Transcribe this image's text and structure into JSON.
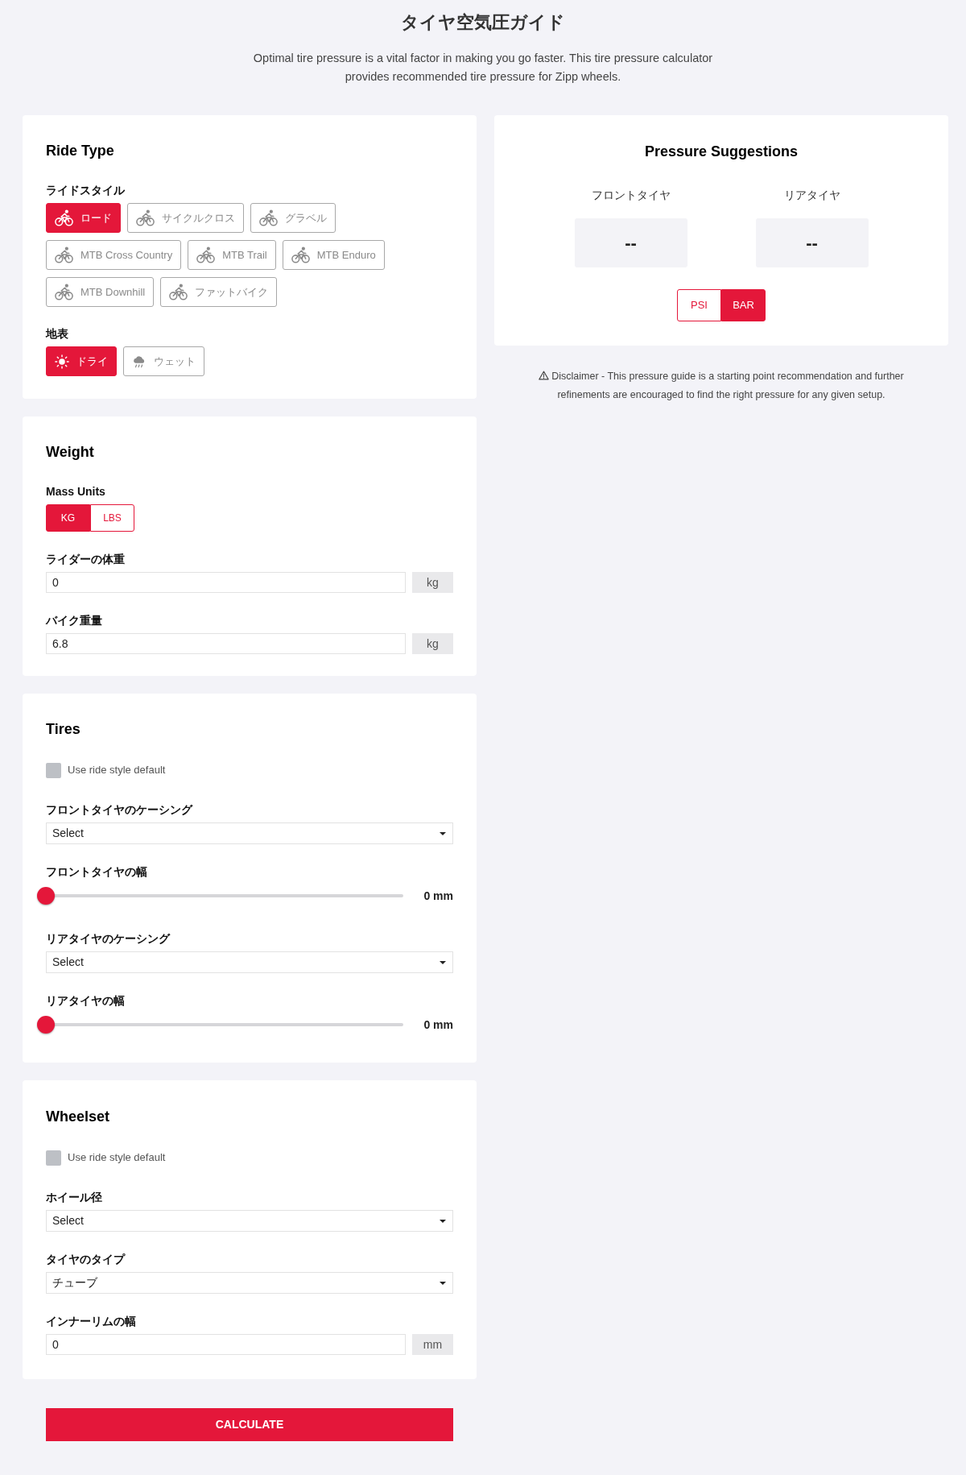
{
  "header": {
    "title": "タイヤ空気圧ガイド",
    "subtitle": "Optimal tire pressure is a vital factor in making you go faster. This tire pressure calculator provides recommended tire pressure for Zipp wheels."
  },
  "ride_type": {
    "title": "Ride Type",
    "ride_style": {
      "label": "ライドスタイル",
      "options": [
        {
          "label": "ロード",
          "selected": true
        },
        {
          "label": "サイクルクロス",
          "selected": false
        },
        {
          "label": "グラベル",
          "selected": false
        },
        {
          "label": "MTB Cross Country",
          "selected": false
        },
        {
          "label": "MTB Trail",
          "selected": false
        },
        {
          "label": "MTB Enduro",
          "selected": false
        },
        {
          "label": "MTB Downhill",
          "selected": false
        },
        {
          "label": "ファットバイク",
          "selected": false
        }
      ]
    },
    "surface": {
      "label": "地表",
      "options": [
        {
          "label": "ドライ",
          "kind": "sun",
          "selected": true
        },
        {
          "label": "ウェット",
          "kind": "rain",
          "selected": false
        }
      ]
    }
  },
  "weight": {
    "title": "Weight",
    "mass_units": {
      "label": "Mass Units",
      "options": [
        {
          "label": "KG",
          "selected": true
        },
        {
          "label": "LBS",
          "selected": false
        }
      ]
    },
    "fields": [
      {
        "label": "ライダーの体重",
        "value": "0",
        "unit": "kg"
      },
      {
        "label": "バイク重量",
        "value": "6.8",
        "unit": "kg"
      }
    ]
  },
  "tires": {
    "title": "Tires",
    "default_checkbox": {
      "label": "Use ride style default",
      "checked": false
    },
    "controls": [
      {
        "kind": "select",
        "label": "フロントタイヤのケーシング",
        "value": "Select"
      },
      {
        "kind": "slider",
        "label": "フロントタイヤの幅",
        "level": 0,
        "reading": "0 mm"
      },
      {
        "kind": "select",
        "label": "リアタイヤのケーシング",
        "value": "Select"
      },
      {
        "kind": "slider",
        "label": "リアタイヤの幅",
        "level": 0,
        "reading": "0 mm"
      }
    ]
  },
  "wheelset": {
    "title": "Wheelset",
    "default_checkbox": {
      "label": "Use ride style default",
      "checked": false
    },
    "controls": [
      {
        "kind": "select",
        "label": "ホイール径",
        "value": "Select"
      },
      {
        "kind": "select",
        "label": "タイヤのタイプ",
        "value": "チューブ"
      },
      {
        "kind": "input",
        "label": "インナーリムの幅",
        "value": "0",
        "unit": "mm"
      }
    ]
  },
  "calculate_button": {
    "label": "CALCULATE"
  },
  "pressure_suggestions": {
    "title": "Pressure Suggestions",
    "tires": [
      {
        "label": "フロントタイヤ",
        "value": "--"
      },
      {
        "label": "リアタイヤ",
        "value": "--"
      }
    ],
    "units": [
      {
        "label": "PSI",
        "selected": false
      },
      {
        "label": "BAR",
        "selected": true
      }
    ]
  },
  "disclaimer": "Disclaimer - This pressure guide is a starting point recommendation and further refinements are encouraged to find the right pressure for any given setup."
}
